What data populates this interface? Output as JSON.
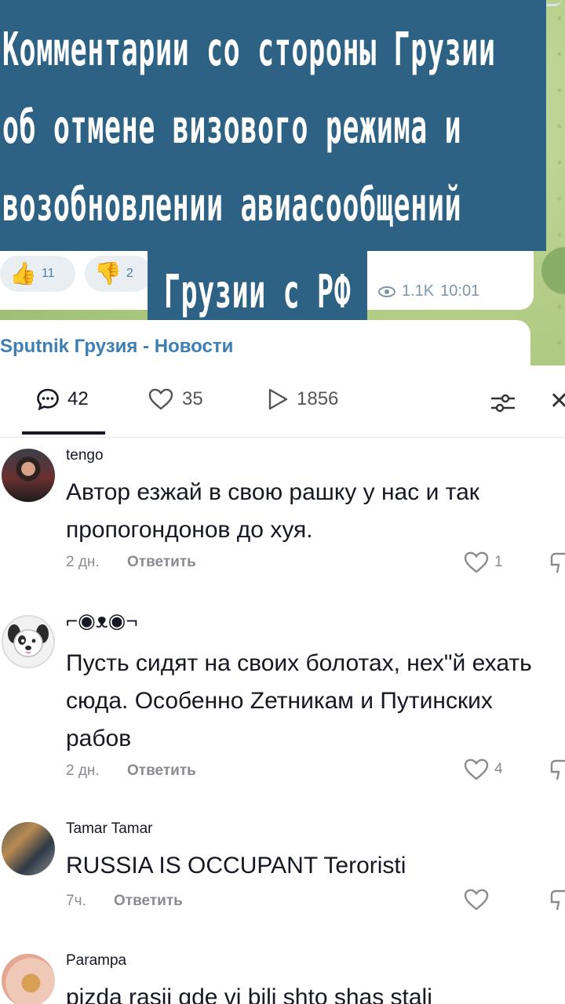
{
  "post_image": {
    "title_lines": [
      "Комментарии со стороны Грузии",
      "об отмене визового режима и",
      "возобновлении авиасообщений"
    ],
    "title_last_line": "Грузии с РФ",
    "reaction_up_count": "11",
    "reaction_down_count": "2",
    "views": "1.1K",
    "time": "10:01",
    "source": "Sputnik Грузия - Новости"
  },
  "stats": {
    "comments": "42",
    "likes": "35",
    "plays": "1856"
  },
  "comments": [
    {
      "username": "tengo",
      "text": "Автор езжай в свою рашку у нас и так\nпропогондонов до хуя.",
      "time": "2 дн.",
      "reply": "Ответить",
      "likes": "1"
    },
    {
      "username": "⌐◉ᴥ◉¬",
      "text": "Пусть сидят на своих болотах, нех\"й ехать\nсюда. Особенно Zетникам и Путинских\nрабов",
      "time": "2 дн.",
      "reply": "Ответить",
      "likes": "4"
    },
    {
      "username": "Tamar Tamar",
      "text": "RUSSIA IS OCCUPANT Teroristi",
      "time": "7ч.",
      "reply": "Ответить",
      "likes": ""
    },
    {
      "username": "Parampa",
      "text": "pizda rasii gde vi bili shto shas stali",
      "time": "",
      "reply": "",
      "likes": ""
    }
  ]
}
